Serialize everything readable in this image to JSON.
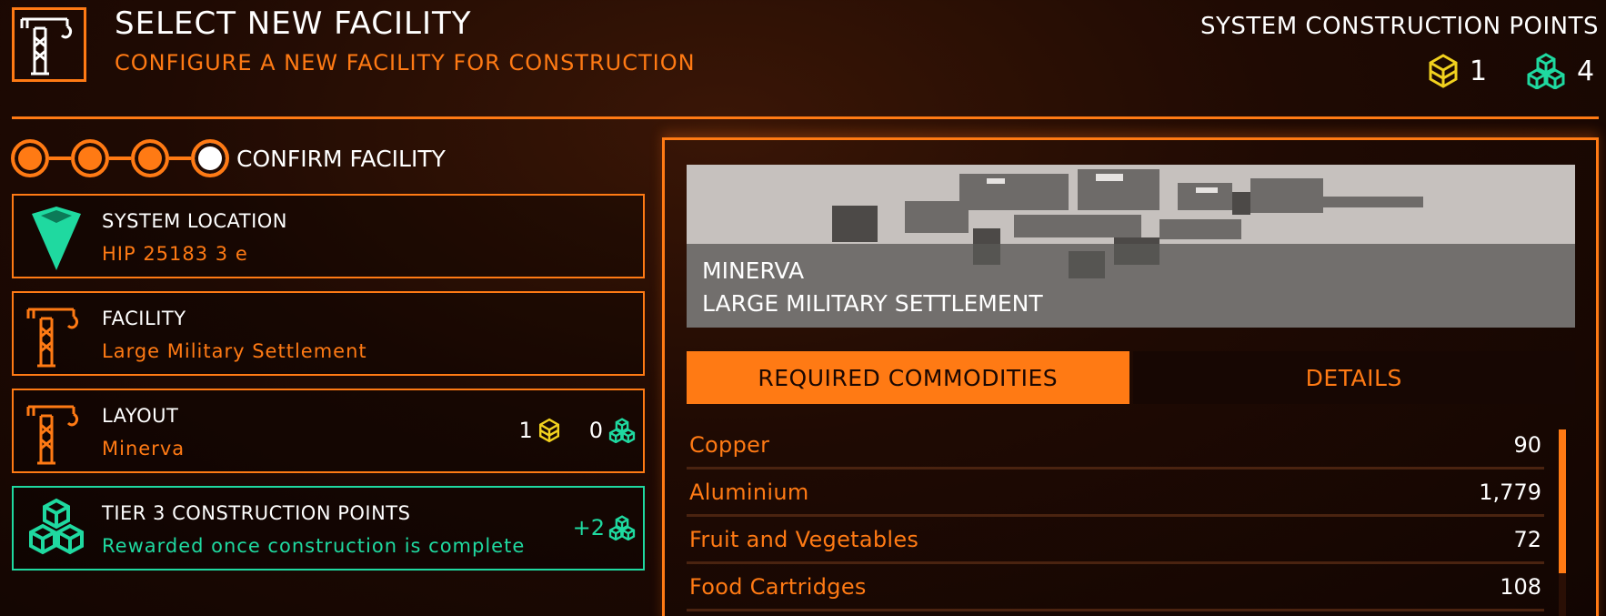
{
  "header": {
    "title": "SELECT NEW FACILITY",
    "subtitle": "CONFIGURE A NEW FACILITY FOR CONSTRUCTION",
    "points_label": "SYSTEM CONSTRUCTION POINTS",
    "tier2_points": "1",
    "tier3_points": "4"
  },
  "steps": {
    "current_label": "CONFIRM FACILITY"
  },
  "panels": {
    "location": {
      "title": "SYSTEM LOCATION",
      "value": "HIP 25183 3 e"
    },
    "facility": {
      "title": "FACILITY",
      "value": "Large Military Settlement"
    },
    "layout": {
      "title": "LAYOUT",
      "value": "Minerva",
      "tier2_cost": "1",
      "tier3_cost": "0"
    },
    "reward": {
      "title": "TIER 3 CONSTRUCTION POINTS",
      "value": "Rewarded once construction is complete",
      "amount": "+2"
    }
  },
  "preview": {
    "name": "MINERVA",
    "type": "LARGE MILITARY SETTLEMENT"
  },
  "tabs": [
    {
      "label": "REQUIRED COMMODITIES",
      "active": true
    },
    {
      "label": "DETAILS",
      "active": false
    }
  ],
  "commodities": [
    {
      "name": "Copper",
      "qty": "90"
    },
    {
      "name": "Aluminium",
      "qty": "1,779"
    },
    {
      "name": "Fruit and Vegetables",
      "qty": "72"
    },
    {
      "name": "Food Cartridges",
      "qty": "108"
    }
  ],
  "colors": {
    "accent": "#ff7a14",
    "teal": "#1fd9a0",
    "tier2": "#f1d11e",
    "background": "#1f0a03"
  },
  "icons": {
    "header": "crane-icon",
    "location": "location-marker-icon",
    "facility": "crane-icon",
    "layout": "crane-icon",
    "reward": "tier3-cubes-icon",
    "tier2": "tier2-cube-icon",
    "tier3": "tier3-cubes-icon"
  }
}
